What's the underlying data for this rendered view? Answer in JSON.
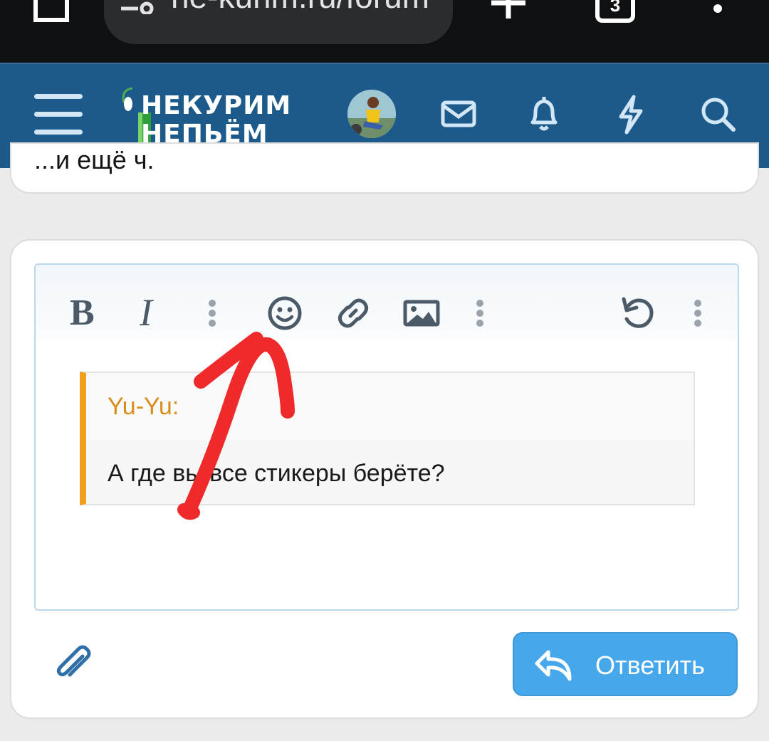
{
  "browser": {
    "url": "ne-kurim.ru/forum",
    "tab_count": "3"
  },
  "header": {
    "logo_line1": "НЕКУРИМ",
    "logo_line2": "НЕПЬЁМ"
  },
  "previous_post": {
    "text_fragment": "...и ещё ч."
  },
  "editor": {
    "bold_label": "B",
    "italic_label": "I",
    "quote": {
      "author": "Yu-Yu:",
      "text": "А где вы все стикеры берёте?"
    }
  },
  "reply_button": {
    "label": "Ответить"
  },
  "colors": {
    "header_bg": "#1b5a8a",
    "accent_blue": "#47a7eb",
    "quote_border": "#f29e1f",
    "annotation_red": "#f02a2a"
  }
}
